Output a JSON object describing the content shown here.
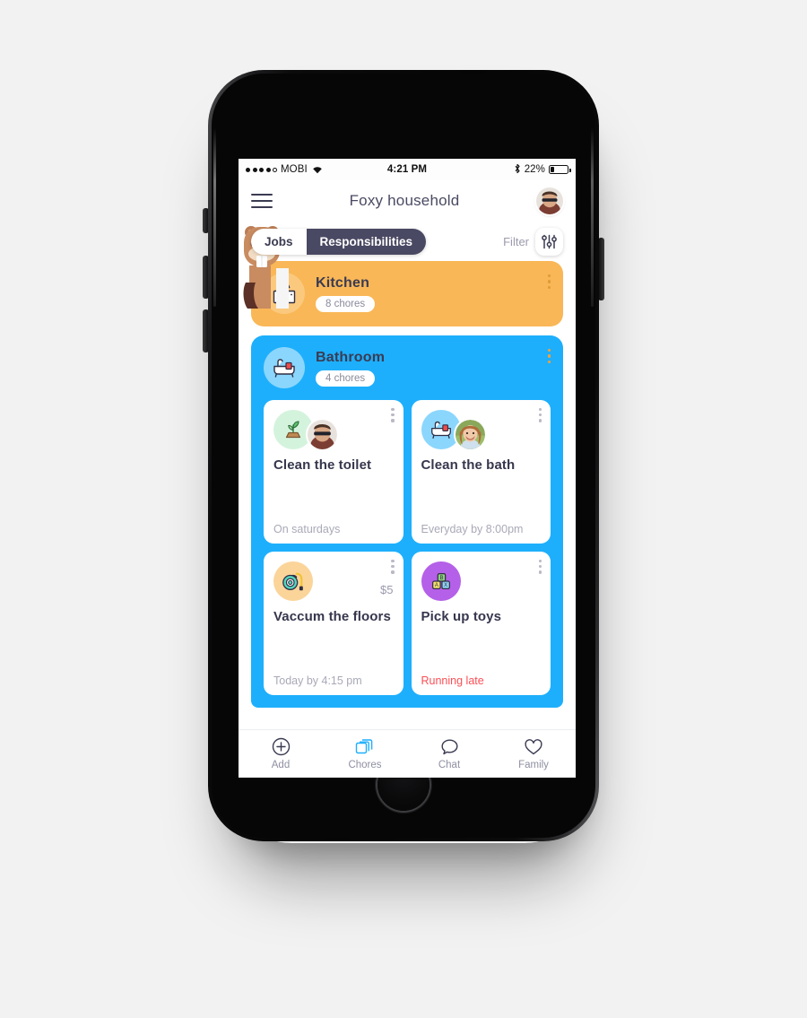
{
  "status_bar": {
    "signal_dots": 5,
    "signal_filled": 4,
    "carrier": "MOBI",
    "wifi_icon": "wifi-icon",
    "time": "4:21 PM",
    "bluetooth_icon": "bluetooth-icon",
    "battery_percent": "22%",
    "battery_level": 22
  },
  "header": {
    "menu_icon": "hamburger-menu-icon",
    "title": "Foxy household",
    "avatar": "user-avatar"
  },
  "tabs": {
    "items": [
      {
        "label": "Jobs",
        "active": false
      },
      {
        "label": "Responsibilities",
        "active": true
      }
    ],
    "filter_label": "Filter",
    "filter_icon": "sliders-icon"
  },
  "groups": [
    {
      "name": "Kitchen",
      "chores_count": "8 chores",
      "icon": "kitchen-stove-icon",
      "color": "#f9b757",
      "icon_bg": "#fbc97e",
      "chores": []
    },
    {
      "name": "Bathroom",
      "chores_count": "4 chores",
      "icon": "bathtub-icon",
      "color": "#1eaffc",
      "icon_bg": "#8bd6fd",
      "chores": [
        {
          "title": "Clean the toilet",
          "schedule": "On saturdays",
          "icon": "plant-sprout-icon",
          "icon_bg": "#d4f3dd",
          "assignee": "man-avatar",
          "reward": "",
          "late": false
        },
        {
          "title": "Clean the bath",
          "schedule": "Everyday by 8:00pm",
          "icon": "bathtub-icon",
          "icon_bg": "#8bd6fd",
          "assignee": "girl-avatar",
          "reward": "",
          "late": false
        },
        {
          "title": "Vaccum the floors",
          "schedule": "Today by 4:15 pm",
          "icon": "vacuum-cleaner-icon",
          "icon_bg": "#fbd49a",
          "assignee": "",
          "reward": "$5",
          "late": false
        },
        {
          "title": "Pick up toys",
          "schedule": "Running late",
          "icon": "toy-blocks-icon",
          "icon_bg": "#b560e8",
          "assignee": "",
          "reward": "",
          "late": true
        }
      ]
    }
  ],
  "tabbar": {
    "items": [
      {
        "label": "Add",
        "icon": "plus-circle-icon",
        "active": false
      },
      {
        "label": "Chores",
        "icon": "cards-stack-icon",
        "active": true
      },
      {
        "label": "Chat",
        "icon": "speech-bubble-icon",
        "active": false
      },
      {
        "label": "Family",
        "icon": "heart-icon",
        "active": false
      }
    ]
  },
  "colors": {
    "accent_blue": "#1eaffc",
    "accent_orange": "#f9b757",
    "dark": "#4a4963",
    "late_red": "#fb4f55"
  }
}
